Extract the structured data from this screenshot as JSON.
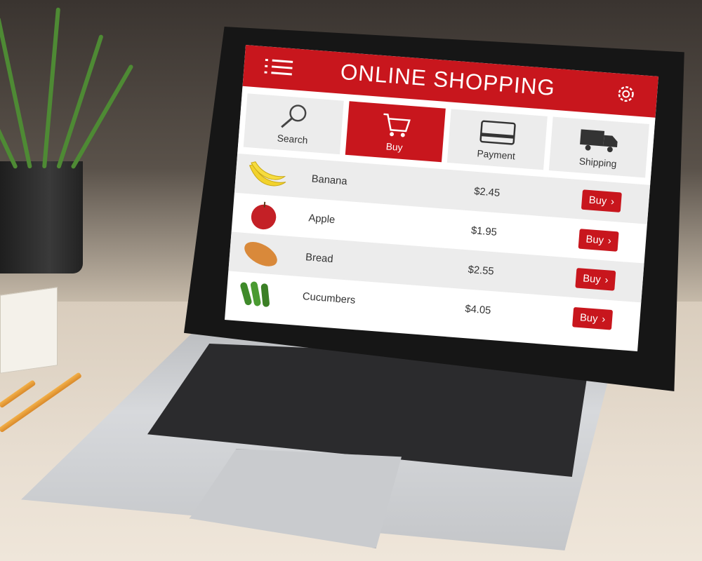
{
  "header": {
    "title": "ONLINE SHOPPING"
  },
  "tabs": [
    {
      "label": "Search",
      "icon": "search-icon",
      "active": false
    },
    {
      "label": "Buy",
      "icon": "cart-icon",
      "active": true
    },
    {
      "label": "Payment",
      "icon": "card-icon",
      "active": false
    },
    {
      "label": "Shipping",
      "icon": "truck-icon",
      "active": false
    }
  ],
  "products": [
    {
      "name": "Banana",
      "price": "$2.45",
      "buy_label": "Buy",
      "icon": "banana-icon"
    },
    {
      "name": "Apple",
      "price": "$1.95",
      "buy_label": "Buy",
      "icon": "apple-icon"
    },
    {
      "name": "Bread",
      "price": "$2.55",
      "buy_label": "Buy",
      "icon": "bread-icon"
    },
    {
      "name": "Cucumbers",
      "price": "$4.05",
      "buy_label": "Buy",
      "icon": "cucumber-icon"
    }
  ],
  "colors": {
    "accent": "#c8161d",
    "row_alt": "#ececec"
  }
}
